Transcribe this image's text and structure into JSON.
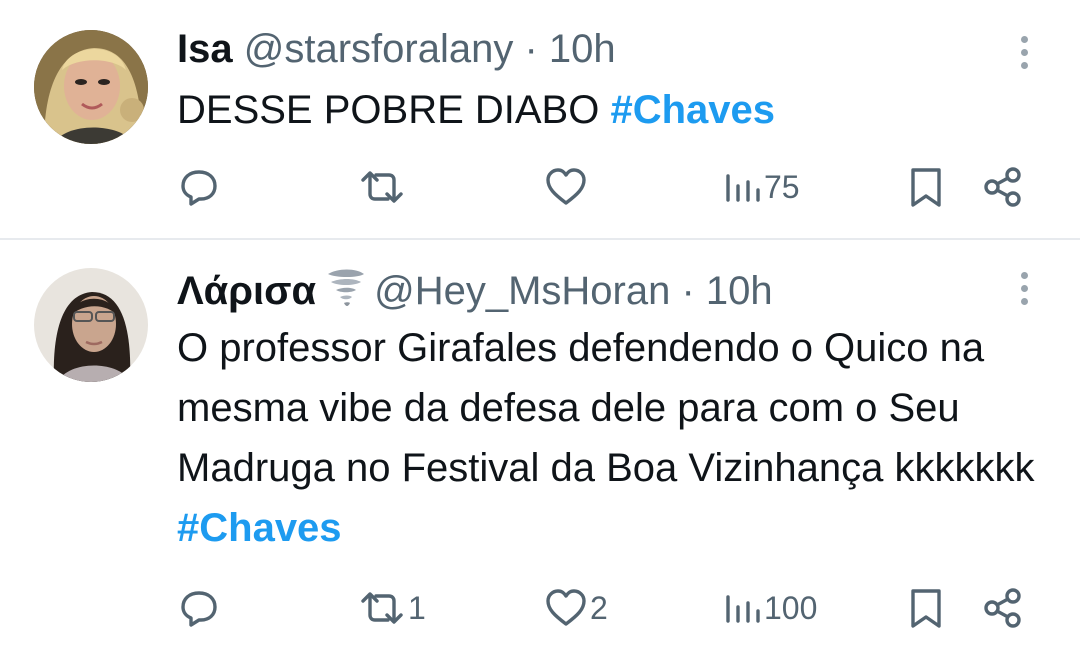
{
  "tweets": [
    {
      "name": "Isa",
      "handle": "@starsforalany",
      "dot": "·",
      "time": "10h",
      "text": "DESSE POBRE DIABO ",
      "hashtag": "#Chaves",
      "reply_count": "",
      "retweet_count": "",
      "like_count": "",
      "view_count": "75"
    },
    {
      "name": "Λάρισα",
      "name_emoji": "tornado-emoji",
      "handle": "@Hey_MsHoran",
      "dot": "·",
      "time": "10h",
      "text": "O professor Girafales defendendo o Quico na mesma vibe da defesa dele para com o Seu Madruga no Festival da Boa Vizinhança kkkkkkk ",
      "hashtag": "#Chaves",
      "reply_count": "",
      "retweet_count": "1",
      "like_count": "2",
      "view_count": "100"
    }
  ],
  "icons": [
    "reply-icon",
    "retweet-icon",
    "like-icon",
    "views-icon",
    "bookmark-icon",
    "share-icon",
    "more-icon"
  ],
  "colors": {
    "accent": "#1d9bf0",
    "muted": "#536471",
    "text": "#0f1419",
    "divider": "#e7eaee"
  }
}
